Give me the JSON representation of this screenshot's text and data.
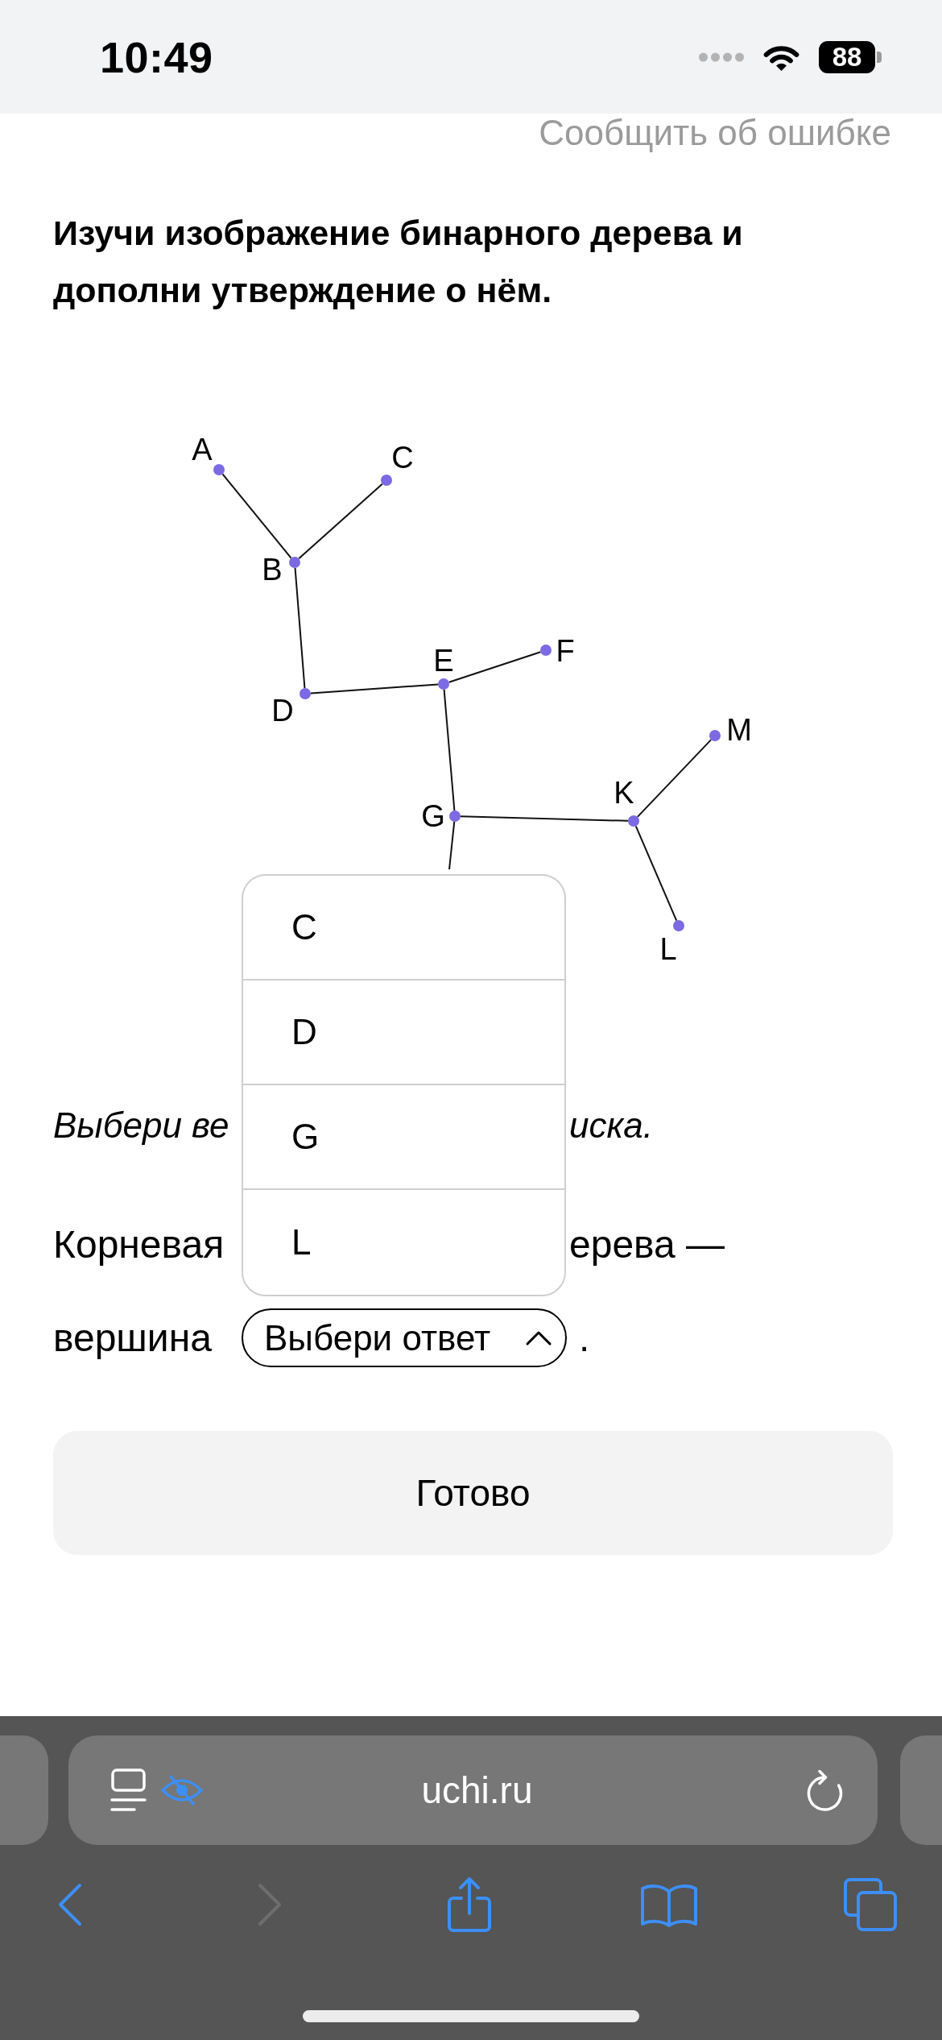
{
  "status_bar": {
    "time": "10:49",
    "battery": "88"
  },
  "report_link": "Сообщить об ошибке",
  "task_title": "Изучи изображение бинарного дерева и дополни утверждение о нём.",
  "diagram": {
    "nodes": [
      {
        "label": "A",
        "kind": "point",
        "children": [
          {
            "label": "B",
            "kind": "point",
            "children": [
              {
                "label": "C",
                "kind": "point"
              },
              {
                "label": "D",
                "kind": "point",
                "children": [
                  {
                    "label": "E",
                    "kind": "point",
                    "children": [
                      {
                        "label": "F",
                        "kind": "point"
                      },
                      {
                        "label": "G",
                        "kind": "point",
                        "children": [
                          {
                            "label": "K",
                            "kind": "point",
                            "children": [
                              {
                                "label": "M",
                                "kind": "point"
                              },
                              {
                                "label": "L",
                                "kind": "point"
                              }
                            ]
                          },
                          {
                            "kind": "covered"
                          }
                        ]
                      }
                    ]
                  }
                ]
              }
            ]
          }
        ]
      }
    ]
  },
  "instruction": [
    "Выбери ве",
    "иска."
  ],
  "statement": {
    "line_1": [
      "Корневая",
      "ерева —"
    ],
    "line_2": "вершина",
    "select": {
      "placeholder": "Выбери ответ",
      "expanded": true,
      "options": [
        {
          "label": "C",
          "selected": false
        },
        {
          "label": "D",
          "selected": false
        },
        {
          "label": "G",
          "selected": false
        },
        {
          "label": "L",
          "selected": false
        }
      ]
    },
    "end": "."
  },
  "done_button": "Готово",
  "browser": {
    "url": "uchi.ru",
    "back": {
      "disabled": false
    },
    "forward": {
      "disabled": true
    }
  }
}
